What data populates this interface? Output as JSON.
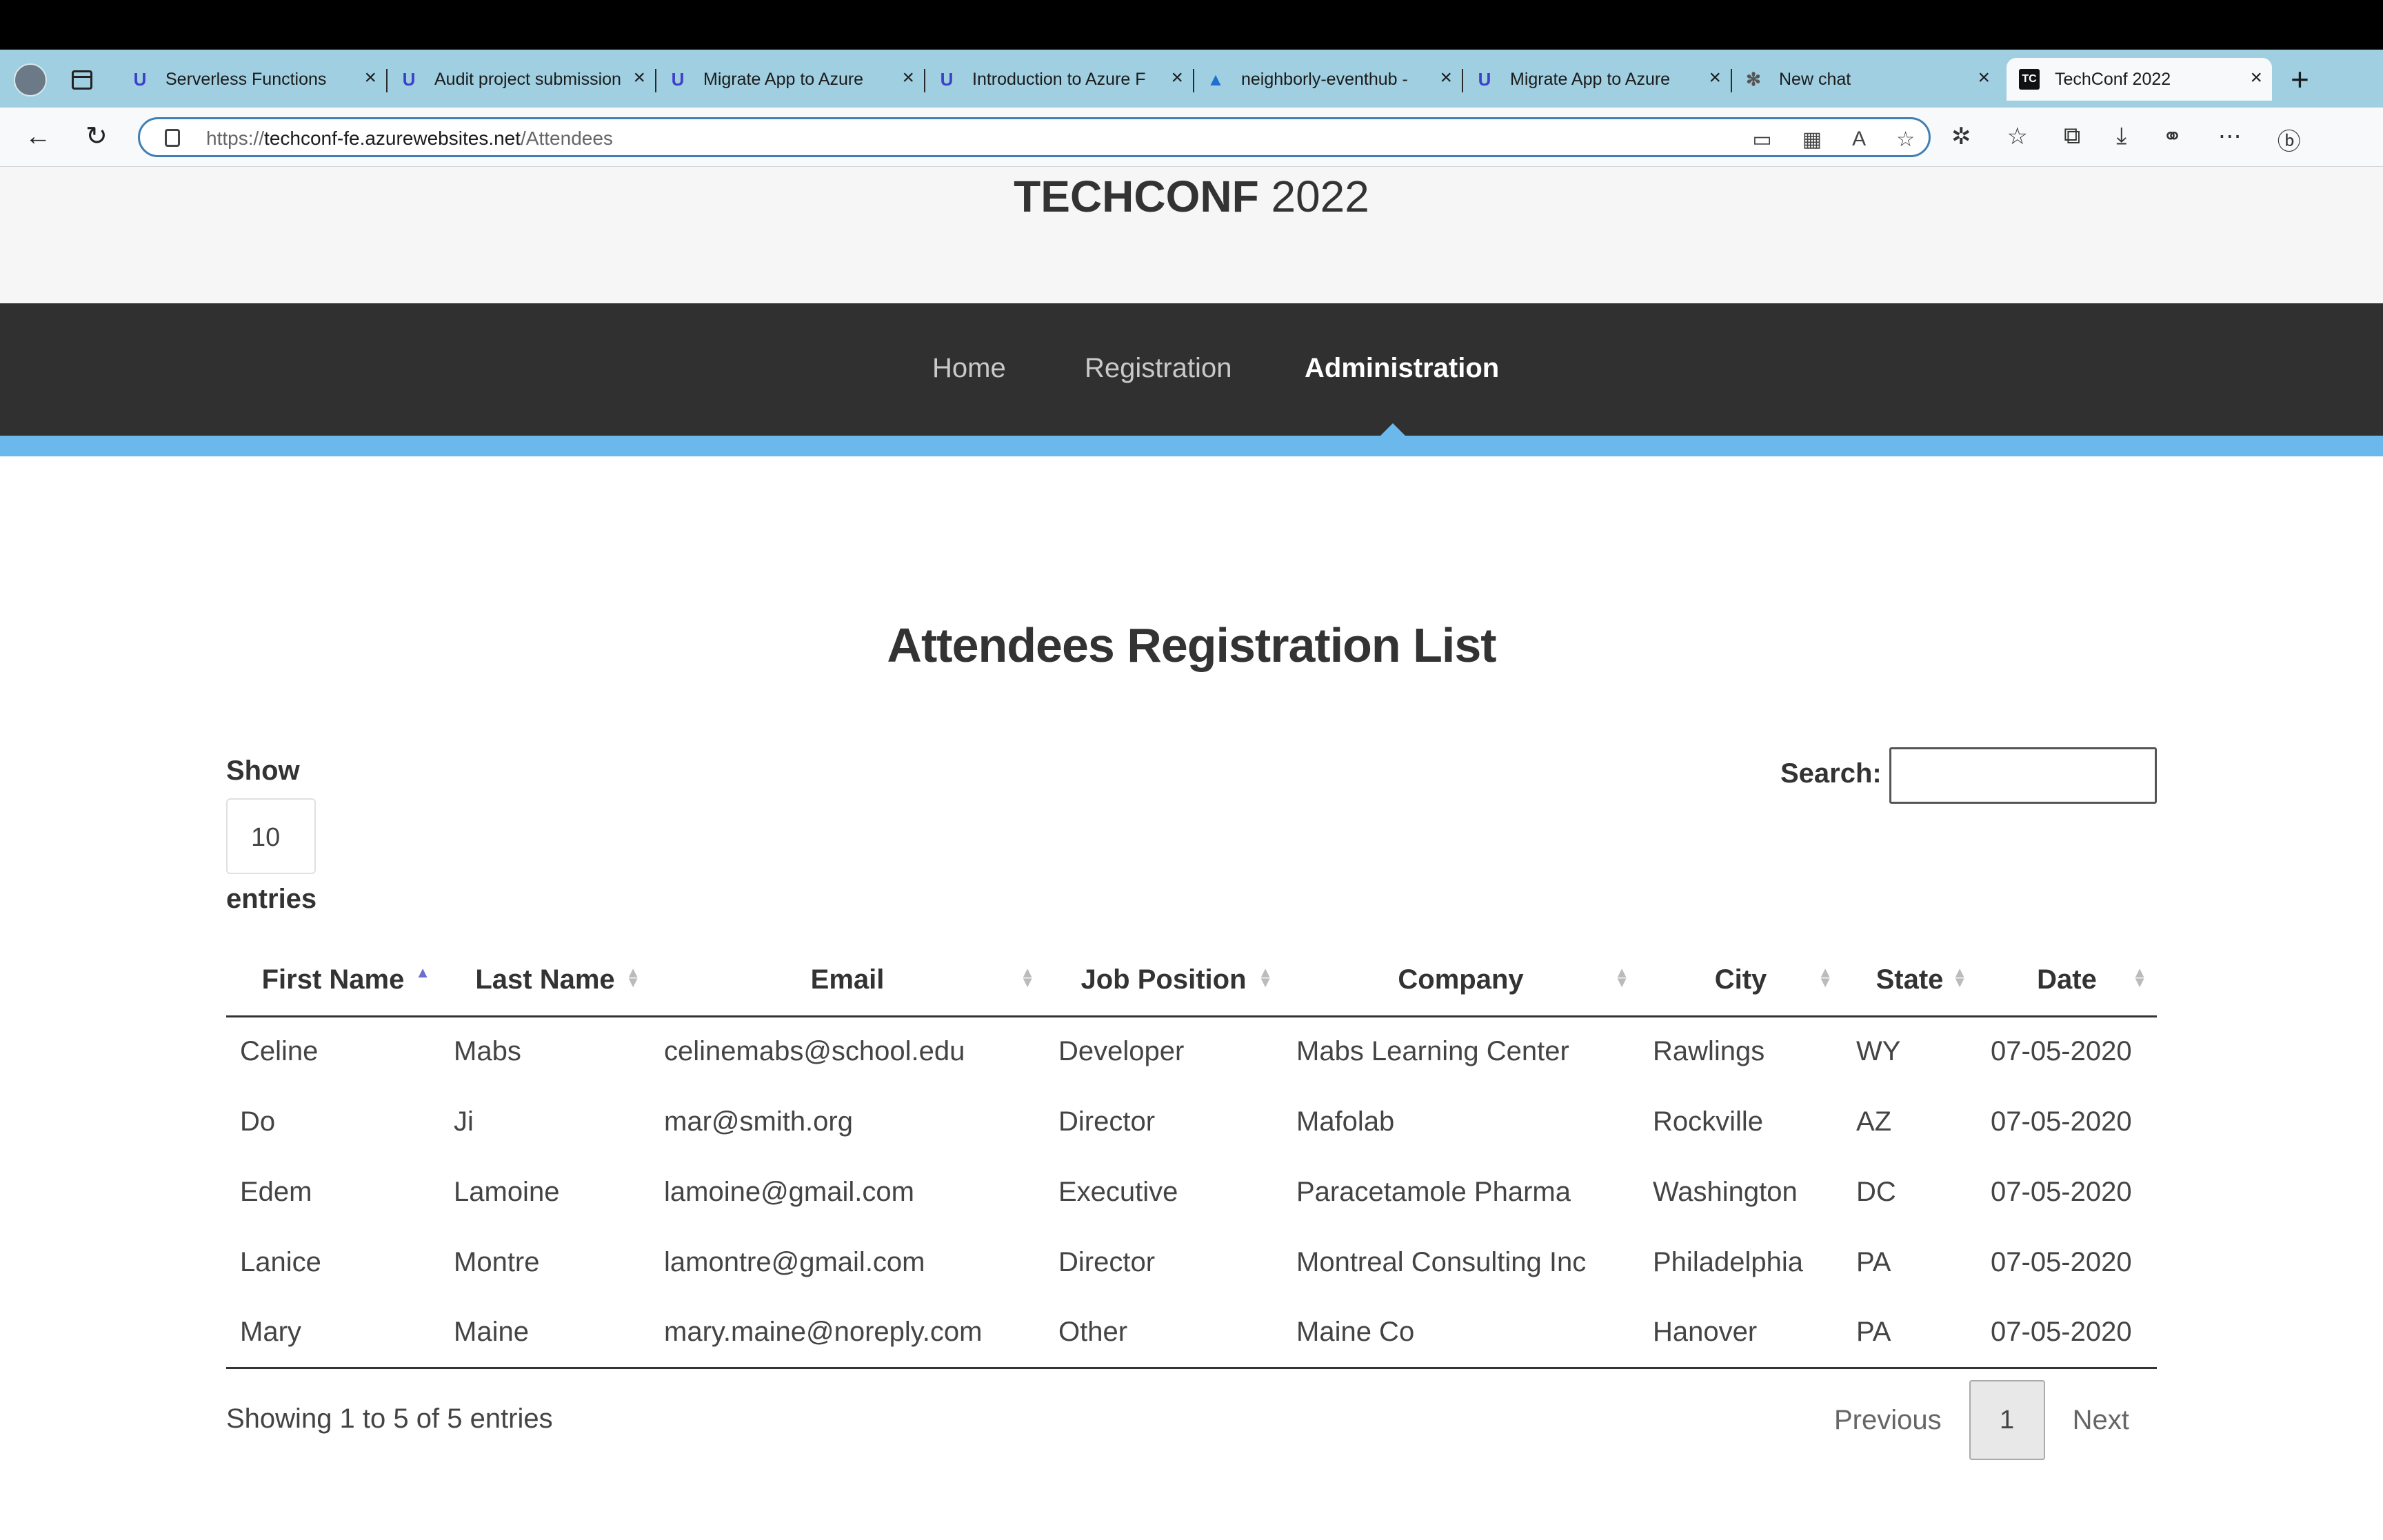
{
  "browser": {
    "tabs": [
      {
        "label": "Serverless Functions",
        "icon": "udacity-icon"
      },
      {
        "label": "Audit project submission",
        "icon": "udacity-icon"
      },
      {
        "label": "Migrate App to Azure",
        "icon": "udacity-icon"
      },
      {
        "label": "Introduction to Azure F",
        "icon": "udacity-icon"
      },
      {
        "label": "neighborly-eventhub -",
        "icon": "azure-icon"
      },
      {
        "label": "Migrate App to Azure",
        "icon": "udacity-icon"
      },
      {
        "label": "New chat",
        "icon": "chatgpt-icon"
      },
      {
        "label": "TechConf 2022",
        "icon": "tc-icon",
        "active": true
      }
    ],
    "url_prefix": "https://",
    "url_host": "techconf-fe.azurewebsites.net",
    "url_path": "/Attendees"
  },
  "site": {
    "brand_bold": "TECHCONF",
    "brand_year": "2022",
    "nav": {
      "home": "Home",
      "registration": "Registration",
      "administration": "Administration"
    },
    "accent_color": "#6bb8ec"
  },
  "page": {
    "title": "Attendees Registration List",
    "show_label": "Show",
    "entries_value": "10",
    "entries_label": "entries",
    "search_label": "Search:",
    "search_value": ""
  },
  "table": {
    "columns": [
      "First Name",
      "Last Name",
      "Email",
      "Job Position",
      "Company",
      "City",
      "State",
      "Date"
    ],
    "rows": [
      [
        "Celine",
        "Mabs",
        "celinemabs@school.edu",
        "Developer",
        "Mabs Learning Center",
        "Rawlings",
        "WY",
        "07-05-2020"
      ],
      [
        "Do",
        "Ji",
        "mar@smith.org",
        "Director",
        "Mafolab",
        "Rockville",
        "AZ",
        "07-05-2020"
      ],
      [
        "Edem",
        "Lamoine",
        "lamoine@gmail.com",
        "Executive",
        "Paracetamole Pharma",
        "Washington",
        "DC",
        "07-05-2020"
      ],
      [
        "Lanice",
        "Montre",
        "lamontre@gmail.com",
        "Director",
        "Montreal Consulting Inc",
        "Philadelphia",
        "PA",
        "07-05-2020"
      ],
      [
        "Mary",
        "Maine",
        "mary.maine@noreply.com",
        "Other",
        "Maine Co",
        "Hanover",
        "PA",
        "07-05-2020"
      ]
    ]
  },
  "footer": {
    "info": "Showing 1 to 5 of 5 entries",
    "previous": "Previous",
    "current_page": "1",
    "next": "Next"
  }
}
